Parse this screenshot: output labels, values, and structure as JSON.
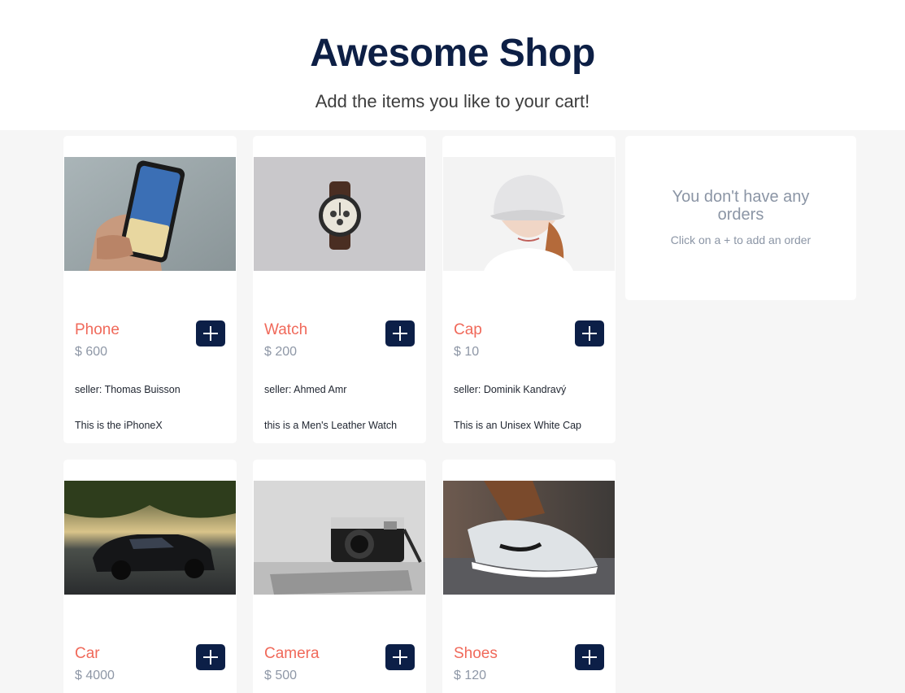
{
  "header": {
    "title": "Awesome Shop",
    "subtitle": "Add the items you like to your cart!"
  },
  "products": [
    {
      "name": "Phone",
      "price": "$ 600",
      "seller": "seller: Thomas Buisson",
      "description": "This is the iPhoneX",
      "image": "phone-in-hand-photo"
    },
    {
      "name": "Watch",
      "price": "$ 200",
      "seller": "seller: Ahmed Amr",
      "description": "this is a Men's Leather Watch",
      "image": "wristwatch-photo"
    },
    {
      "name": "Cap",
      "price": "$ 10",
      "seller": "seller: Dominik Kandravý",
      "description": "This is an Unisex White Cap",
      "image": "white-cap-photo"
    },
    {
      "name": "Car",
      "price": "$ 4000",
      "seller": "",
      "description": "",
      "image": "black-car-photo"
    },
    {
      "name": "Camera",
      "price": "$ 500",
      "seller": "",
      "description": "",
      "image": "camera-photo"
    },
    {
      "name": "Shoes",
      "price": "$ 120",
      "seller": "",
      "description": "",
      "image": "sneakers-photo"
    }
  ],
  "orders": {
    "empty_text": "You don't have any orders",
    "hint": "Click on a + to add an order"
  },
  "colors": {
    "title": "#0d1f45",
    "accent": "#f0695a",
    "button": "#0c1f47",
    "background": "#f6f6f6"
  }
}
